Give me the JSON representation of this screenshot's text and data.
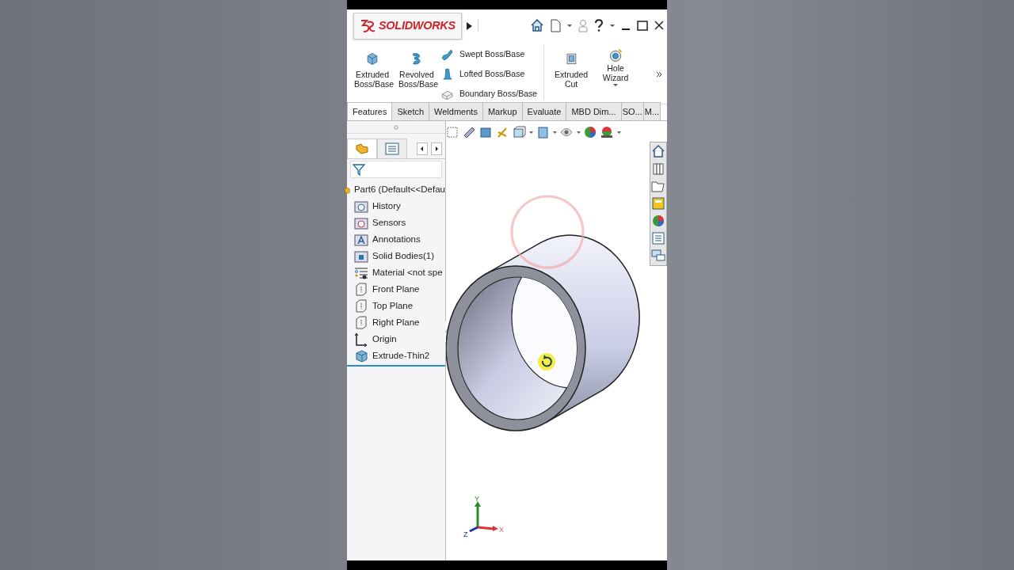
{
  "logo": "**SOLID**WORKS",
  "ribbon": [
    {
      "kind": "large",
      "label": "Extruded Boss/Base"
    },
    {
      "kind": "large",
      "label": "Revolved Boss/Base"
    },
    {
      "kind": "stack",
      "items": [
        {
          "label": "Swept Boss/Base"
        },
        {
          "label": "Lofted Boss/Base"
        },
        {
          "label": "Boundary Boss/Base"
        }
      ]
    },
    {
      "kind": "large",
      "label": "Extruded Cut"
    },
    {
      "kind": "large",
      "label": "Hole Wizard",
      "dropdown": true
    }
  ],
  "tabs": [
    {
      "label": "Features",
      "selected": true
    },
    {
      "label": "Sketch",
      "selected": false
    },
    {
      "label": "Weldments",
      "selected": false
    },
    {
      "label": "Markup",
      "selected": false
    },
    {
      "label": "Evaluate",
      "selected": false
    },
    {
      "label": "MBD Dim...",
      "selected": false
    },
    {
      "label": "SO...",
      "selected": false
    },
    {
      "label": "M...",
      "selected": false
    }
  ],
  "tree": {
    "label": "Part6  (Default<<Defau",
    "children": [
      {
        "label": "History",
        "kind": "history"
      },
      {
        "label": "Sensors",
        "kind": "sensor"
      },
      {
        "label": "Annotations",
        "kind": "annotation"
      },
      {
        "label": "Solid Bodies(1)",
        "kind": "bodies"
      },
      {
        "label": "Material <not spe",
        "kind": "material"
      },
      {
        "label": "Front Plane",
        "kind": "plane"
      },
      {
        "label": "Top Plane",
        "kind": "plane"
      },
      {
        "label": "Right Plane",
        "kind": "plane"
      },
      {
        "label": "Origin",
        "kind": "origin"
      },
      {
        "label": "Extrude-Thin2",
        "kind": "extrude"
      }
    ]
  },
  "triad": {
    "x": "X",
    "y": "Y",
    "z": "Z"
  }
}
